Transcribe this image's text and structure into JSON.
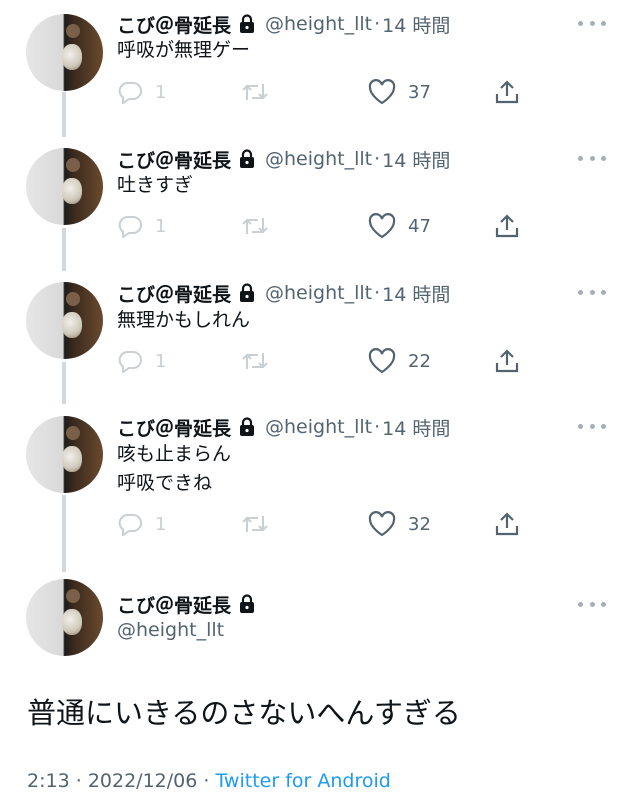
{
  "tweets": [
    {
      "author_name": "こび＠骨延長",
      "handle": "@height_llt",
      "separator": "·",
      "time": "14 時間",
      "text": "呼吸が無理ゲー",
      "replies": "1",
      "likes": "37"
    },
    {
      "author_name": "こび＠骨延長",
      "handle": "@height_llt",
      "separator": "·",
      "time": "14 時間",
      "text": "吐きすぎ",
      "replies": "1",
      "likes": "47"
    },
    {
      "author_name": "こび＠骨延長",
      "handle": "@height_llt",
      "separator": "·",
      "time": "14 時間",
      "text": "無理かもしれん",
      "replies": "1",
      "likes": "22"
    },
    {
      "author_name": "こび＠骨延長",
      "handle": "@height_llt",
      "separator": "·",
      "time": "14 時間",
      "text": "咳も止まらん\n呼吸できね",
      "replies": "1",
      "likes": "32"
    }
  ],
  "main_tweet": {
    "author_name": "こび＠骨延長",
    "handle": "@height_llt",
    "text": "普通にいきるのさないへんすぎる",
    "time": "2:13",
    "separator": "·",
    "date": "2022/12/06",
    "separator2": "·",
    "source": "Twitter for Android"
  },
  "icons": {
    "lock": "lock-icon",
    "more": "more-icon",
    "reply": "reply-icon",
    "retweet": "retweet-icon",
    "like": "heart-icon",
    "share": "share-icon"
  },
  "colors": {
    "text": "#0f1419",
    "secondary": "#536471",
    "link": "#1d9bf0",
    "thread_line": "#cfd9de"
  }
}
